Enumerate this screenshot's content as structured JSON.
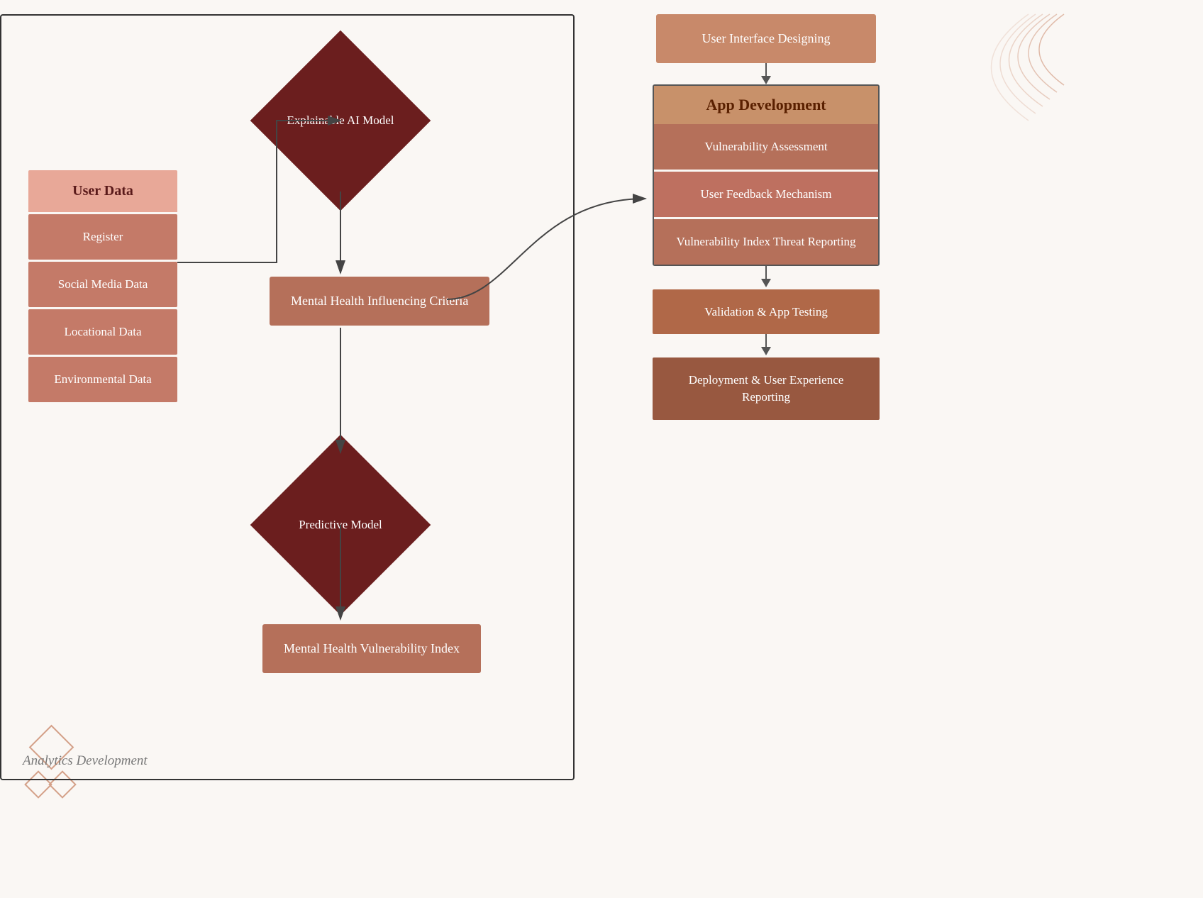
{
  "diagram": {
    "background": "#faf7f4",
    "analytics_label": "Analytics Development",
    "user_data": {
      "header": "User Data",
      "items": [
        "Register",
        "Social Media Data",
        "Locational Data",
        "Environmental Data"
      ]
    },
    "flow_nodes": {
      "explainable_ai": "Explainable AI Model",
      "mhic": "Mental Health Influencing Criteria",
      "predictive_model": "Predictive Model",
      "mhvi": "Mental Health Vulnerability Index"
    },
    "app_dev": {
      "header": "App Development",
      "ui_design": "User Interface Designing",
      "items": [
        "Vulnerability Assessment",
        "User Feedback Mechanism",
        "Vulnerability Index Threat Reporting",
        "Validation & App Testing",
        "Deployment & User Experience Reporting"
      ]
    }
  }
}
